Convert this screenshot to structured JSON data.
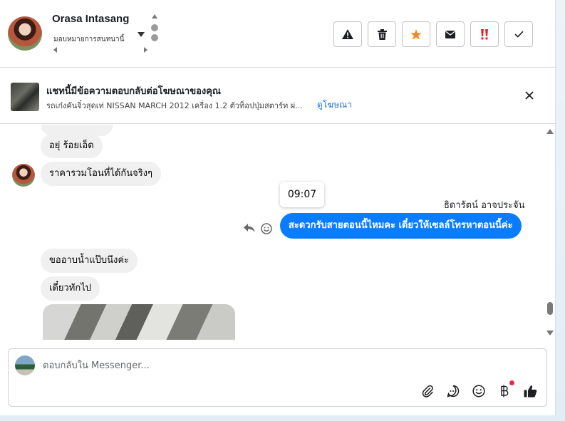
{
  "header": {
    "name": "Orasa Intasang",
    "subtitle": "มอบหมายการสนทนานี้"
  },
  "actions": [
    {
      "id": "spam",
      "icon": "warning-icon"
    },
    {
      "id": "delete",
      "icon": "trash-icon"
    },
    {
      "id": "star",
      "icon": "star-icon",
      "color": "#f08a24"
    },
    {
      "id": "mark-unread",
      "icon": "envelope-icon"
    },
    {
      "id": "follow-up",
      "icon": "double-exclamation-icon",
      "color": "#e4262c"
    },
    {
      "id": "done",
      "icon": "checkmark-icon"
    }
  ],
  "ad": {
    "title": "แชทนี้มีข้อความตอบกลับต่อโฆษณาของคุณ",
    "text": "รถเก๋งคันจิ๋วสุดเท่ NISSAN MARCH 2012 เครื่อง 1.2 ตัวท็อปปุ่มสตาร์ท ผ่...",
    "link": "ดูโฆษณา"
  },
  "messages": {
    "in1": "อยุ่ ร้อยเอ็ด",
    "in2": "ราคารวมโอนที่ได้กันจริงๆ",
    "tooltip_time": "09:07",
    "sender": "ธิดารัตน์ อาจประจัน",
    "out1": "สะดวกรับสายตอนนี้ไหมคะ เดี๋ยวให้เซลล์โทรหาตอนนี้ค่ะ",
    "in3": "ขออาบน้ำแป๊บนึงค่ะ",
    "in4": "เดี๋ยวทักไป"
  },
  "composer": {
    "placeholder": "ตอบกลับใน Messenger...",
    "tools": [
      "paperclip-icon",
      "saved-replies-icon",
      "emoji-icon",
      "baht-payment-icon",
      "thumbs-up-icon"
    ]
  }
}
